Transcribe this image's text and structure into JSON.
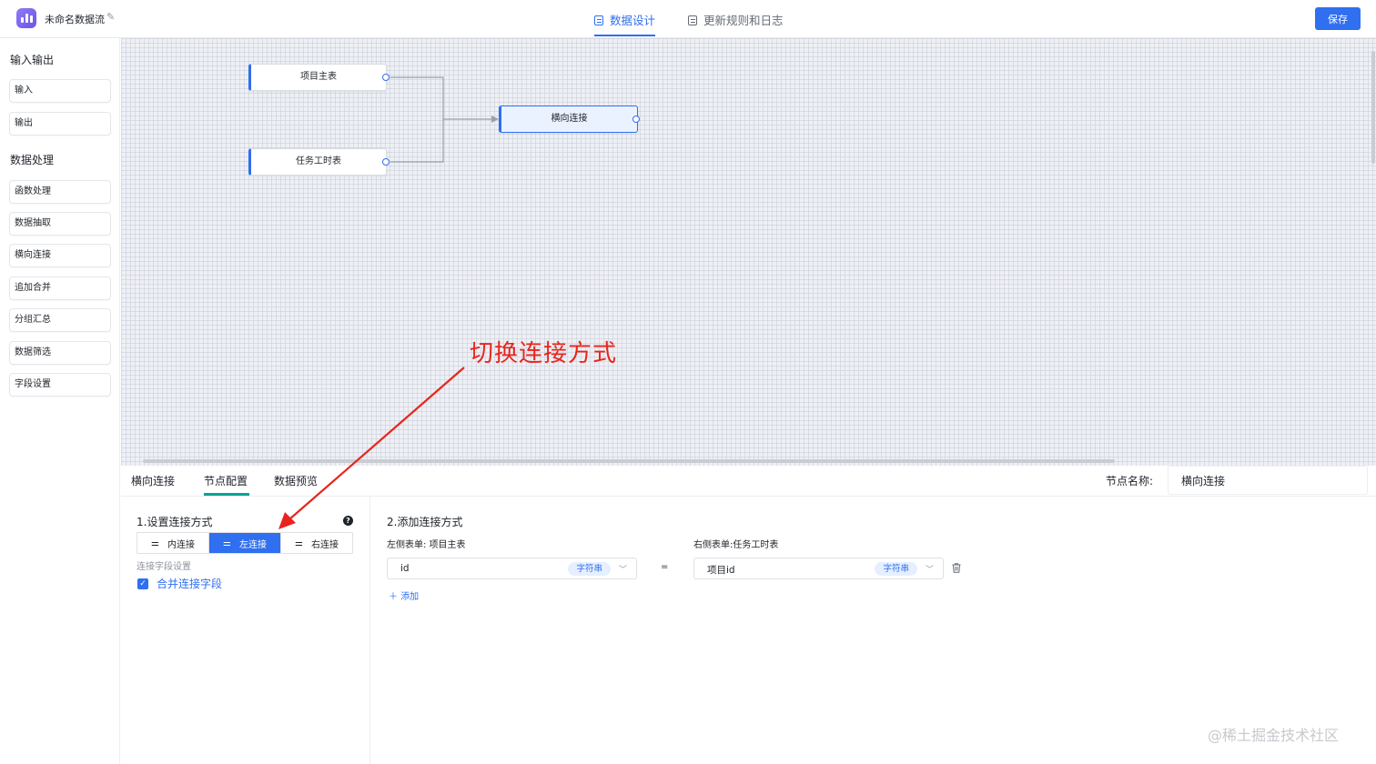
{
  "header": {
    "app_title": "未命名数据流",
    "tabs": [
      {
        "label": "数据设计",
        "active": true
      },
      {
        "label": "更新规则和日志",
        "active": false
      }
    ],
    "save_label": "保存"
  },
  "sidebar": {
    "sections": [
      {
        "title": "输入输出",
        "items": [
          "输入",
          "输出"
        ]
      },
      {
        "title": "数据处理",
        "items": [
          "函数处理",
          "数据抽取",
          "横向连接",
          "追加合并",
          "分组汇总",
          "数据筛选",
          "字段设置"
        ]
      }
    ]
  },
  "canvas": {
    "nodes": [
      {
        "label": "项目主表"
      },
      {
        "label": "任务工时表"
      },
      {
        "label": "横向连接",
        "selected": true
      }
    ]
  },
  "config": {
    "tabs": [
      "横向连接",
      "节点配置",
      "数据预览"
    ],
    "active_tab": "节点配置",
    "node_name_label": "节点名称:",
    "node_name_value": "横向连接",
    "left": {
      "title": "1.设置连接方式",
      "help_icon": "?",
      "join_types": [
        {
          "label": "内连接",
          "active": false
        },
        {
          "label": "左连接",
          "active": true
        },
        {
          "label": "右连接",
          "active": false
        }
      ],
      "field_settings_label": "连接字段设置",
      "merge_checked": true,
      "merge_label": "合并连接字段"
    },
    "right": {
      "title": "2.添加连接方式",
      "left_table_label": "左侧表单:  项目主表",
      "right_table_label": "右侧表单:任务工时表",
      "left_field": "id",
      "left_field_type": "字符串",
      "equals": "=",
      "right_field": "项目id",
      "right_field_type": "字符串",
      "add_label": "添加"
    }
  },
  "annotation": {
    "text": "切换连接方式",
    "color": "#e8251c"
  },
  "watermark": "@稀土掘金技术社区",
  "colors": {
    "accent": "#2f6ff0",
    "tab_underline": "#00a596",
    "logo": "#7b63ee"
  },
  "icons": {
    "logo": "bar-chart-icon",
    "edit": "pencil-icon",
    "help": "question-circle-icon",
    "delete": "trash-icon",
    "join": "sliders-icon"
  }
}
